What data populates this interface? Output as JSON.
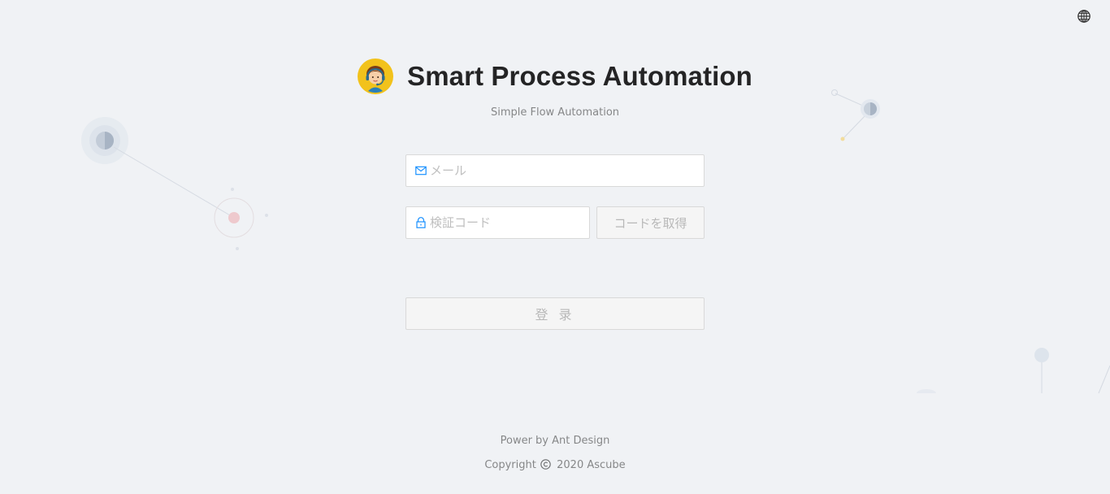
{
  "app": {
    "title": "Smart Process Automation",
    "subtitle": "Simple Flow Automation"
  },
  "header": {
    "language_icon": "globe-icon",
    "logo_icon": "support-agent-avatar"
  },
  "form": {
    "email": {
      "placeholder": "メール",
      "value": "",
      "icon": "mail-icon"
    },
    "code": {
      "placeholder": "検証コード",
      "value": "",
      "icon": "lock-icon"
    },
    "get_code_label": "コードを取得",
    "login_label": "登 录"
  },
  "footer": {
    "powered_by": "Power by Ant Design",
    "copyright_prefix": "Copyright",
    "copyright_rest": "2020 Ascube"
  },
  "colors": {
    "background": "#f0f2f5",
    "accent": "#1890ff",
    "logo_bg": "#f5c518",
    "disabled_bg": "#f5f5f5"
  }
}
